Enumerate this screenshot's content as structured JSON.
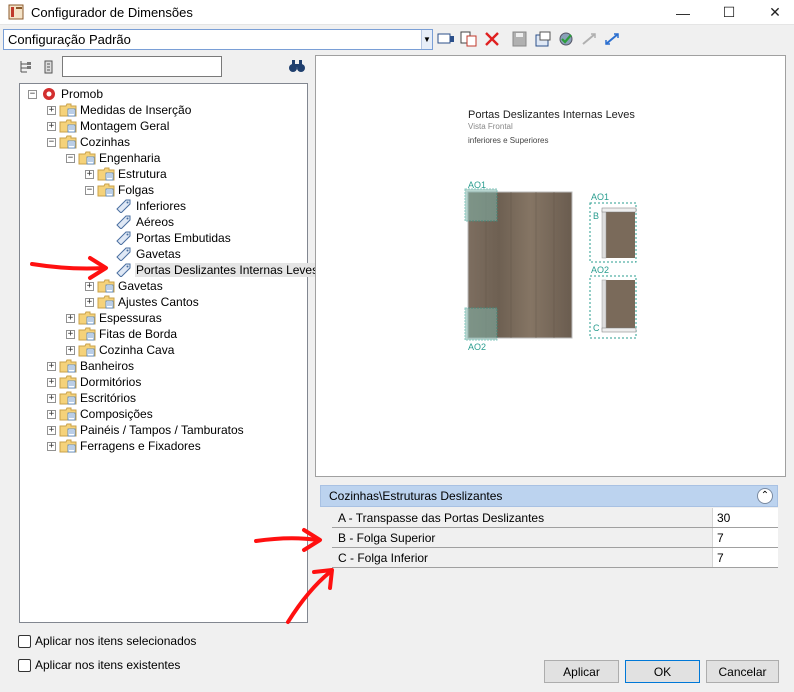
{
  "window": {
    "title": "Configurador de Dimensões"
  },
  "toolbar": {
    "config_value": "Configuração Padrão",
    "icons": [
      "insert-icon",
      "copy-icon",
      "delete-icon",
      "save-icon",
      "export-icon",
      "apply-icon",
      "shrink-icon",
      "expand-icon"
    ]
  },
  "tree": {
    "search_placeholder": "",
    "nodes": [
      {
        "label": "Promob",
        "depth": 0,
        "icon": "promob-logo-icon",
        "expander": "-"
      },
      {
        "label": "Medidas de Inserção",
        "depth": 1,
        "icon": "folder-icon",
        "expander": "+"
      },
      {
        "label": "Montagem Geral",
        "depth": 1,
        "icon": "folder-icon",
        "expander": "+"
      },
      {
        "label": "Cozinhas",
        "depth": 1,
        "icon": "folder-icon",
        "expander": "-"
      },
      {
        "label": "Engenharia",
        "depth": 2,
        "icon": "folder-icon",
        "expander": "-"
      },
      {
        "label": "Estrutura",
        "depth": 3,
        "icon": "folder-icon",
        "expander": "+"
      },
      {
        "label": "Folgas",
        "depth": 3,
        "icon": "folder-icon",
        "expander": "-"
      },
      {
        "label": "Inferiores",
        "depth": 4,
        "icon": "tag-icon",
        "expander": ""
      },
      {
        "label": "Aéreos",
        "depth": 4,
        "icon": "tag-icon",
        "expander": ""
      },
      {
        "label": "Portas Embutidas",
        "depth": 4,
        "icon": "tag-icon",
        "expander": ""
      },
      {
        "label": "Gavetas",
        "depth": 4,
        "icon": "tag-icon",
        "expander": ""
      },
      {
        "label": "Portas Deslizantes Internas Leves",
        "depth": 4,
        "icon": "tag-icon",
        "expander": "",
        "selected": true
      },
      {
        "label": "Gavetas",
        "depth": 3,
        "icon": "folder-icon",
        "expander": "+"
      },
      {
        "label": "Ajustes Cantos",
        "depth": 3,
        "icon": "folder-icon",
        "expander": "+"
      },
      {
        "label": "Espessuras",
        "depth": 2,
        "icon": "folder-icon",
        "expander": "+"
      },
      {
        "label": "Fitas de Borda",
        "depth": 2,
        "icon": "folder-icon",
        "expander": "+"
      },
      {
        "label": "Cozinha Cava",
        "depth": 2,
        "icon": "folder-icon",
        "expander": "+"
      },
      {
        "label": "Banheiros",
        "depth": 1,
        "icon": "folder-icon",
        "expander": "+"
      },
      {
        "label": "Dormitórios",
        "depth": 1,
        "icon": "folder-icon",
        "expander": "+"
      },
      {
        "label": "Escritórios",
        "depth": 1,
        "icon": "folder-icon",
        "expander": "+"
      },
      {
        "label": "Composições",
        "depth": 1,
        "icon": "folder-icon",
        "expander": "+"
      },
      {
        "label": "Painéis / Tampos / Tamburatos",
        "depth": 1,
        "icon": "folder-icon",
        "expander": "+"
      },
      {
        "label": "Ferragens e Fixadores",
        "depth": 1,
        "icon": "folder-icon",
        "expander": "+"
      }
    ]
  },
  "preview": {
    "title": "Portas Deslizantes Internas Leves",
    "subtitle": "Vista Frontal",
    "subtitle2": "inferiores e Superiores",
    "labels": {
      "ao1_left": "AO1",
      "ao2_left": "AO2",
      "ao1_right": "AO1",
      "ao2_right": "AO2",
      "b": "B",
      "c": "C"
    }
  },
  "properties": {
    "category": "Cozinhas\\Estruturas Deslizantes",
    "rows": [
      {
        "name": "A - Transpasse das Portas Deslizantes",
        "value": "30"
      },
      {
        "name": "B - Folga Superior",
        "value": "7"
      },
      {
        "name": "C - Folga Inferior",
        "value": "7"
      }
    ]
  },
  "options": {
    "apply_selected": "Aplicar nos itens selecionados",
    "apply_existing": "Aplicar nos itens existentes"
  },
  "buttons": {
    "apply": "Aplicar",
    "ok": "OK",
    "cancel": "Cancelar"
  },
  "colors": {
    "accent": "#0078d7",
    "annotation_arrow": "#ff0000",
    "header_bg": "#bcd3ef",
    "wood": "#7a6a5a",
    "dimension_teal": "#2a9d8f"
  }
}
